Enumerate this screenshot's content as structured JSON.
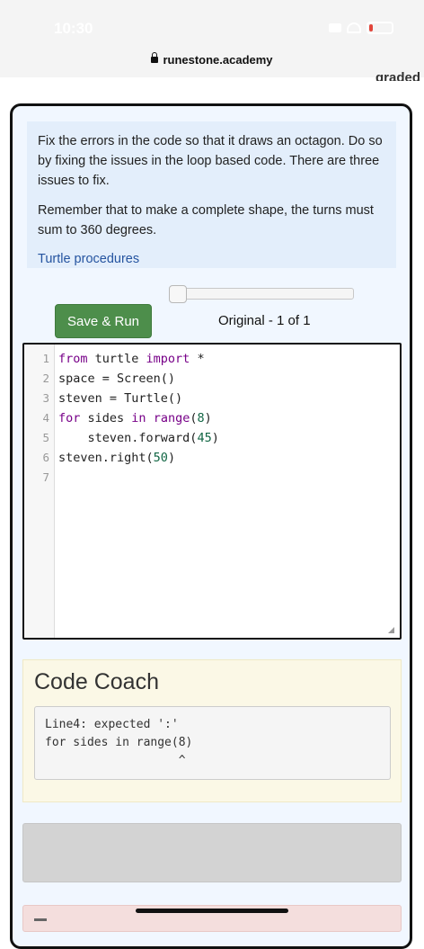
{
  "status_bar": {
    "time": "10:30",
    "battery_level": 0.17
  },
  "browser": {
    "domain": "runestone.academy",
    "partial_heading": "graded"
  },
  "instructions": {
    "paragraph1": "Fix the errors in the code so that it draws an octagon. Do so by fixing the issues in the loop based code. There are three issues to fix.",
    "paragraph2": "Remember that to make a complete shape, the turns must sum to 360 degrees.",
    "link": "Turtle procedures"
  },
  "toolbar": {
    "save_run_label": "Save & Run",
    "version_label": "Original - 1 of 1",
    "history_position": 0
  },
  "editor": {
    "line_numbers": [
      "1",
      "2",
      "3",
      "4",
      "5",
      "6",
      "7"
    ],
    "lines": [
      [
        {
          "t": "from",
          "c": "kw"
        },
        {
          "t": " turtle ",
          "c": ""
        },
        {
          "t": "import",
          "c": "kw"
        },
        {
          "t": " *",
          "c": ""
        }
      ],
      [
        {
          "t": "space = Screen()",
          "c": ""
        }
      ],
      [
        {
          "t": "steven = Turtle()",
          "c": ""
        }
      ],
      [
        {
          "t": "for",
          "c": "kw"
        },
        {
          "t": " sides ",
          "c": ""
        },
        {
          "t": "in",
          "c": "kw"
        },
        {
          "t": " ",
          "c": ""
        },
        {
          "t": "range",
          "c": "kw"
        },
        {
          "t": "(",
          "c": ""
        },
        {
          "t": "8",
          "c": "num"
        },
        {
          "t": ")",
          "c": ""
        }
      ],
      [
        {
          "t": "    steven.forward(",
          "c": ""
        },
        {
          "t": "45",
          "c": "num"
        },
        {
          "t": ")",
          "c": ""
        }
      ],
      [
        {
          "t": "steven.right(",
          "c": ""
        },
        {
          "t": "50",
          "c": "num"
        },
        {
          "t": ")",
          "c": ""
        }
      ],
      []
    ]
  },
  "code_coach": {
    "title": "Code Coach",
    "message_lines": [
      "Line4: expected ':'",
      "for sides in range(8)",
      "                   ^"
    ]
  }
}
